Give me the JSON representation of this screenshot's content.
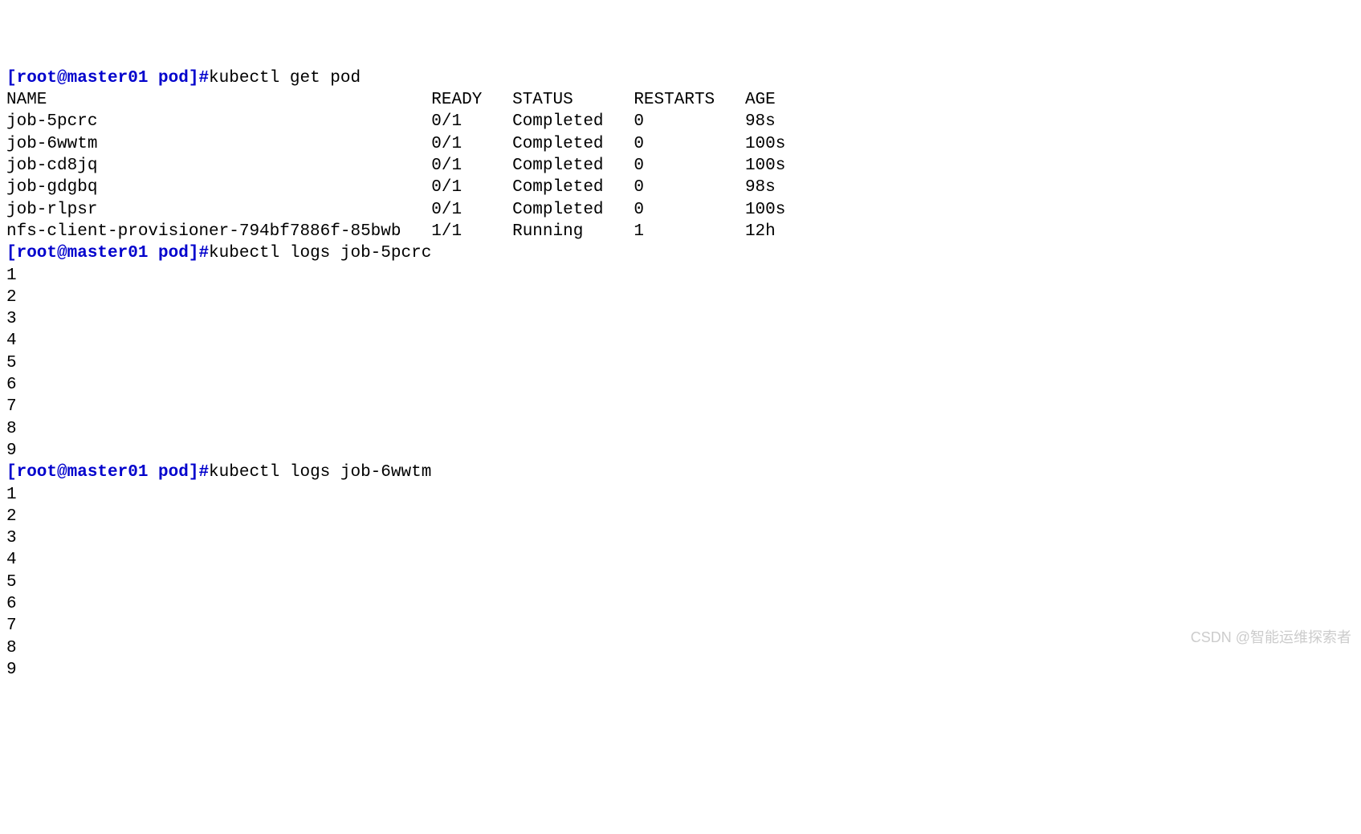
{
  "prompt1": {
    "user_host_path": "[root@master01 pod]#",
    "command": "kubectl get pod"
  },
  "table": {
    "headers": {
      "name": "NAME",
      "ready": "READY",
      "status": "STATUS",
      "restarts": "RESTARTS",
      "age": "AGE"
    },
    "rows": [
      {
        "name": "job-5pcrc",
        "ready": "0/1",
        "status": "Completed",
        "restarts": "0",
        "age": "98s"
      },
      {
        "name": "job-6wwtm",
        "ready": "0/1",
        "status": "Completed",
        "restarts": "0",
        "age": "100s"
      },
      {
        "name": "job-cd8jq",
        "ready": "0/1",
        "status": "Completed",
        "restarts": "0",
        "age": "100s"
      },
      {
        "name": "job-gdgbq",
        "ready": "0/1",
        "status": "Completed",
        "restarts": "0",
        "age": "98s"
      },
      {
        "name": "job-rlpsr",
        "ready": "0/1",
        "status": "Completed",
        "restarts": "0",
        "age": "100s"
      },
      {
        "name": "nfs-client-provisioner-794bf7886f-85bwb",
        "ready": "1/1",
        "status": "Running",
        "restarts": "1",
        "age": "12h"
      }
    ]
  },
  "prompt2": {
    "user_host_path": "[root@master01 pod]#",
    "command": "kubectl logs job-5pcrc"
  },
  "logs1": [
    "1",
    "2",
    "3",
    "4",
    "5",
    "6",
    "7",
    "8",
    "9"
  ],
  "prompt3": {
    "user_host_path": "[root@master01 pod]#",
    "command": "kubectl logs job-6wwtm"
  },
  "logs2": [
    "1",
    "2",
    "3",
    "4",
    "5",
    "6",
    "7",
    "8",
    "9"
  ],
  "watermark": "CSDN @智能运维探索者",
  "col_widths": {
    "name": 42,
    "ready": 8,
    "status": 12,
    "restarts": 11
  }
}
